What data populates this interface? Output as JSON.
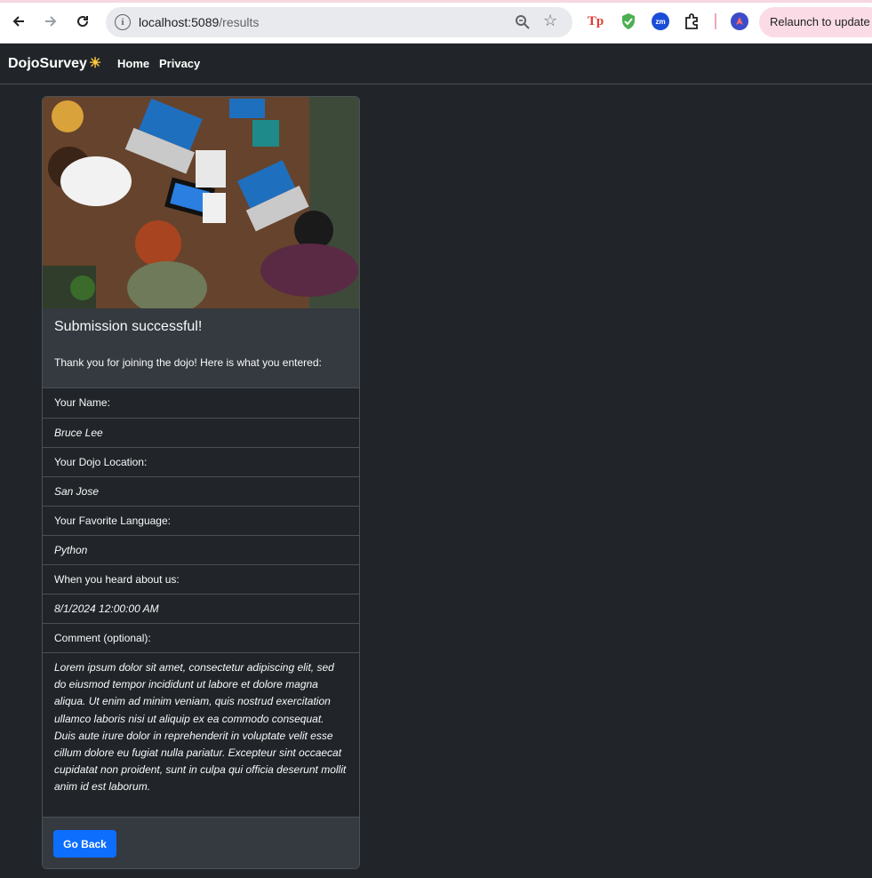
{
  "browser": {
    "url_host": "localhost:5089",
    "url_path": "/results",
    "relaunch_label": "Relaunch to update",
    "ext_tp_label": "Tp",
    "ext_zm_label": "zm",
    "info_label": "i"
  },
  "navbar": {
    "brand": "DojoSurvey",
    "brand_icon": "sun-icon",
    "links": [
      "Home",
      "Privacy"
    ]
  },
  "card": {
    "image_icon": "people-at-table-with-laptops-photo",
    "title": "Submission successful!",
    "text": "Thank you for joining the dojo! Here is what you entered:",
    "fields": [
      {
        "label": "Your Name:",
        "value": "Bruce Lee"
      },
      {
        "label": "Your Dojo Location:",
        "value": "San Jose"
      },
      {
        "label": "Your Favorite Language:",
        "value": "Python"
      },
      {
        "label": "When you heard about us:",
        "value": "8/1/2024 12:00:00 AM"
      },
      {
        "label": "Comment (optional):",
        "value": "Lorem ipsum dolor sit amet, consectetur adipiscing elit, sed do eiusmod tempor incididunt ut labore et dolore magna aliqua. Ut enim ad minim veniam, quis nostrud exercitation ullamco laboris nisi ut aliquip ex ea commodo consequat. Duis aute irure dolor in reprehenderit in voluptate velit esse cillum dolore eu fugiat nulla pariatur. Excepteur sint occaecat cupidatat non proident, sunt in culpa qui officia deserunt mollit anim id est laborum."
      }
    ],
    "back_button": "Go Back"
  },
  "colors": {
    "background": "#212529",
    "card_body": "#343a40",
    "primary": "#0d6efd"
  }
}
